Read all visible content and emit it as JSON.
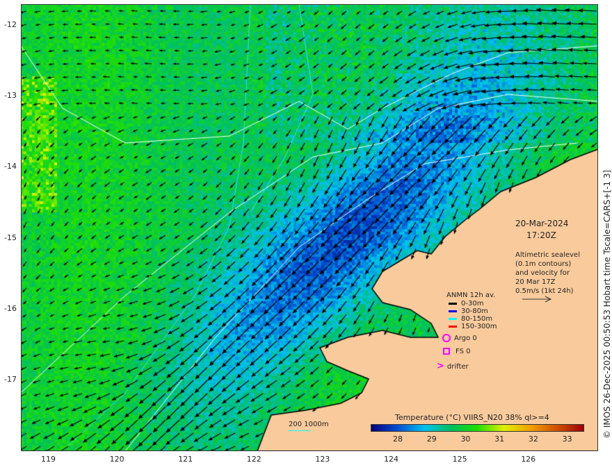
{
  "map": {
    "lon_ticks": [
      "119",
      "120",
      "121",
      "122",
      "123",
      "124",
      "125",
      "126"
    ],
    "lat_ticks": [
      "-12",
      "-13",
      "-14",
      "-15",
      "-16",
      "-17"
    ],
    "date": "20-Mar-2024",
    "time": "17:20Z",
    "description": [
      "Altimetric sealevel",
      "(0.1m contours)",
      "and velocity for",
      "20 Mar 17Z",
      "0.5m/s (1kt 24h)"
    ],
    "credit": "© IMOS 26-Dec-2025 00:50:53 Hobart time Tscale=CARS+[-1 3]",
    "land_color": "#f9cb9c",
    "contour_color": "#ffffff",
    "isobath_color": "#40e0e0"
  },
  "legend": {
    "title": "ANMN 12h av.",
    "items": [
      {
        "label": "0-30m",
        "color": "#000000"
      },
      {
        "label": "30-80m",
        "color": "#0000ff"
      },
      {
        "label": "80-150m",
        "color": "#00ffff"
      },
      {
        "label": "150-300m",
        "color": "#ff0000"
      }
    ],
    "argo": "Argo 0",
    "fs": "FS 0",
    "drifter": "drifter",
    "marker_color": "#ff00ff"
  },
  "isobath_legend": "200  1000m",
  "colorbar": {
    "title": "Temperature (°C) VIIRS_N20 38% ql>=4",
    "ticks": [
      "28",
      "29",
      "30",
      "31",
      "32",
      "33"
    ],
    "range": [
      27.2,
      33.5
    ],
    "colors": [
      "#00007f",
      "#0050d0",
      "#00c0f0",
      "#00c060",
      "#20e000",
      "#e0f000",
      "#f0a000",
      "#d05000",
      "#9f0000"
    ]
  }
}
